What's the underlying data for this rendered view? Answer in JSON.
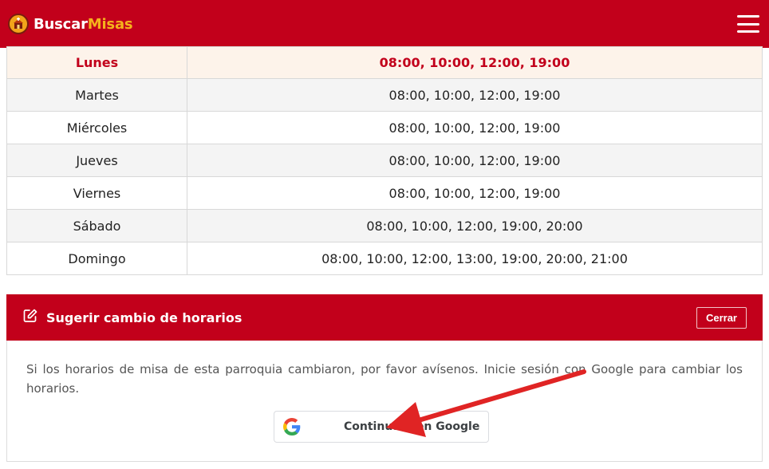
{
  "header": {
    "brand_part1": "Buscar",
    "brand_part2": "Misas",
    "logo_icon": "church-emblem-icon",
    "menu_icon": "hamburger-menu-icon"
  },
  "schedule": {
    "rows": [
      {
        "day": "Lunes",
        "times": "08:00, 10:00, 12:00, 19:00",
        "highlighted": true
      },
      {
        "day": "Martes",
        "times": "08:00, 10:00, 12:00, 19:00"
      },
      {
        "day": "Miércoles",
        "times": "08:00, 10:00, 12:00, 19:00"
      },
      {
        "day": "Jueves",
        "times": "08:00, 10:00, 12:00, 19:00"
      },
      {
        "day": "Viernes",
        "times": "08:00, 10:00, 12:00, 19:00"
      },
      {
        "day": "Sábado",
        "times": "08:00, 10:00, 12:00, 19:00, 20:00"
      },
      {
        "day": "Domingo",
        "times": "08:00, 10:00, 12:00, 13:00, 19:00, 20:00, 21:00"
      }
    ]
  },
  "suggest": {
    "title": "Sugerir cambio de horarios",
    "title_icon": "edit-icon",
    "close_label": "Cerrar",
    "text": "Si los horarios de misa de esta parroquia cambiaron, por favor avísenos. Inicie sesión con Google para cambiar los horarios.",
    "google_button_label": "Continuar con Google",
    "google_icon": "google-g-icon"
  },
  "colors": {
    "brand_red": "#c2001b",
    "brand_yellow": "#f5b21c",
    "annotation_arrow": "#e02424"
  }
}
